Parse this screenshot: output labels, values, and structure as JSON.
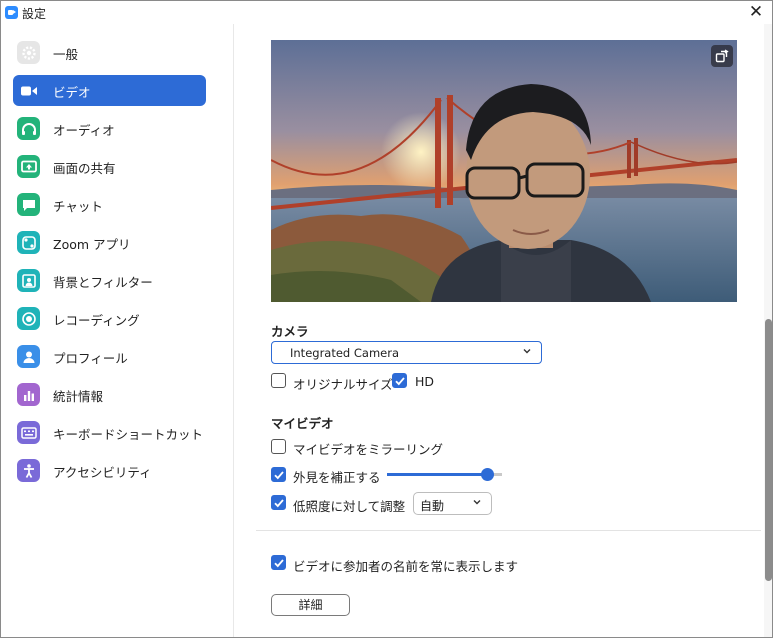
{
  "window": {
    "title": "設定",
    "close_glyph": "✕"
  },
  "sidebar": {
    "items": [
      {
        "label": "一般",
        "icon": "gear-icon",
        "color": "#e4e4e4",
        "active": false
      },
      {
        "label": "ビデオ",
        "icon": "video-camera-icon",
        "color": "#2d6bd6",
        "active": true
      },
      {
        "label": "オーディオ",
        "icon": "headphones-icon",
        "color": "#23b37a",
        "active": false
      },
      {
        "label": "画面の共有",
        "icon": "share-screen-icon",
        "color": "#23b37a",
        "active": false
      },
      {
        "label": "チャット",
        "icon": "chat-bubble-icon",
        "color": "#23b37a",
        "active": false
      },
      {
        "label": "Zoom アプリ",
        "icon": "apps-icon",
        "color": "#1fb3b8",
        "active": false
      },
      {
        "label": "背景とフィルター",
        "icon": "background-icon",
        "color": "#1fb3b8",
        "active": false
      },
      {
        "label": "レコーディング",
        "icon": "record-icon",
        "color": "#1fb3b8",
        "active": false
      },
      {
        "label": "プロフィール",
        "icon": "profile-icon",
        "color": "#3a8fe8",
        "active": false
      },
      {
        "label": "統計情報",
        "icon": "statistics-icon",
        "color": "#a266cf",
        "active": false
      },
      {
        "label": "キーボードショートカット",
        "icon": "keyboard-icon",
        "color": "#7a6ad8",
        "active": false
      },
      {
        "label": "アクセシビリティ",
        "icon": "accessibility-icon",
        "color": "#7a6ad8",
        "active": false
      }
    ]
  },
  "video": {
    "camera_label": "カメラ",
    "camera_selected": "Integrated Camera",
    "original_size_label": "オリジナルサイズ",
    "original_size_checked": false,
    "hd_label": "HD",
    "hd_checked": true,
    "my_video_label": "マイビデオ",
    "mirror_label": "マイビデオをミラーリング",
    "mirror_checked": false,
    "touch_up_label": "外見を補正する",
    "touch_up_checked": true,
    "touch_up_level": 0.87,
    "low_light_label": "低照度に対して調整",
    "low_light_checked": true,
    "low_light_mode": "自動",
    "show_names_label": "ビデオに参加者の名前を常に表示します",
    "show_names_checked": true,
    "advanced_button": "詳細"
  },
  "colors": {
    "accent": "#2d6bd6"
  }
}
